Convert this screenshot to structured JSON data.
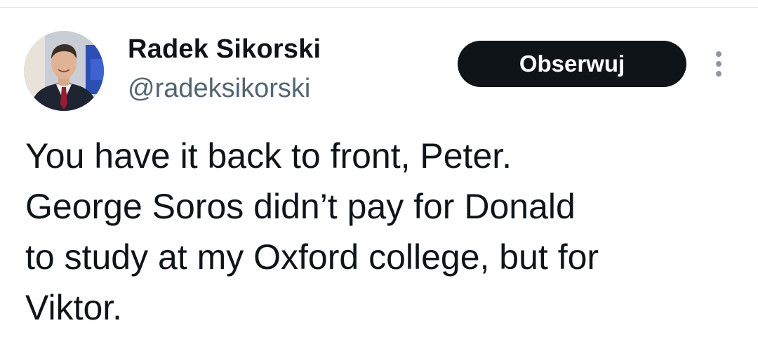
{
  "author": {
    "display_name": "Radek Sikorski",
    "handle": "@radeksikorski",
    "avatar_icon": "profile-photo"
  },
  "actions": {
    "follow_label": "Obserwuj",
    "more_icon": "more-vertical-icon"
  },
  "tweet": {
    "lines": [
      "You have it back to front, Peter.",
      "George Soros didn’t pay for Donald",
      "to study at my Oxford college, but for",
      "Viktor."
    ]
  },
  "colors": {
    "text_primary": "#0f1419",
    "text_secondary": "#536471",
    "button_bg": "#0f1419",
    "button_text": "#ffffff"
  }
}
